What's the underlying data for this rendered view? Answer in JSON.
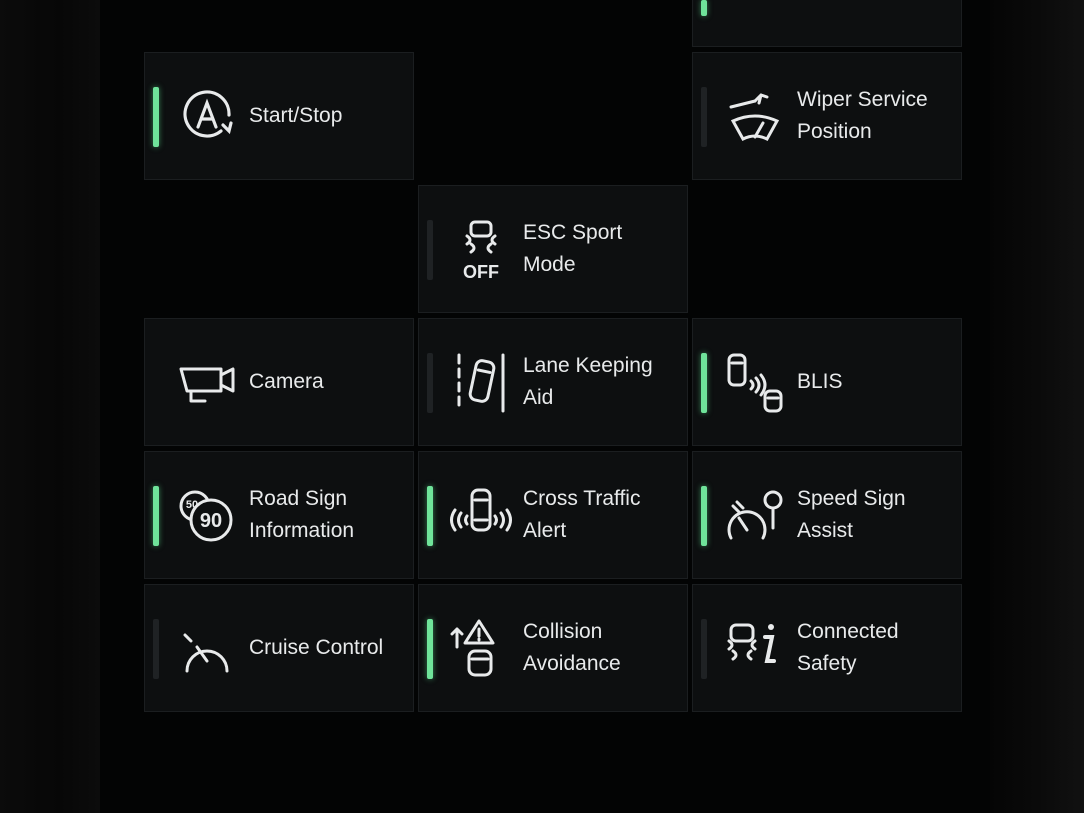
{
  "tiles": {
    "start_stop": {
      "label": "Start/Stop",
      "icon": "auto-start-stop-icon",
      "active": true
    },
    "wiper": {
      "label": "Wiper Service\nPosition",
      "icon": "wiper-service-icon",
      "active": false
    },
    "esc": {
      "label": "ESC Sport Mode",
      "icon": "esc-off-icon",
      "active": false
    },
    "camera": {
      "label": "Camera",
      "icon": "camera-icon",
      "active": false
    },
    "lane": {
      "label": "Lane Keeping\nAid",
      "icon": "lane-keeping-icon",
      "active": false
    },
    "blis": {
      "label": "BLIS",
      "icon": "blind-spot-icon",
      "active": true
    },
    "road_sign": {
      "label": "Road Sign\nInformation",
      "icon": "road-sign-icon",
      "active": true,
      "sign_small": "50",
      "sign_large": "90"
    },
    "cross_traffic": {
      "label": "Cross Traffic\nAlert",
      "icon": "cross-traffic-icon",
      "active": true
    },
    "speed_sign": {
      "label": "Speed Sign\nAssist",
      "icon": "speed-sign-icon",
      "active": true
    },
    "cruise": {
      "label": "Cruise Control",
      "icon": "cruise-control-icon",
      "active": false
    },
    "collision": {
      "label": "Collision\nAvoidance",
      "icon": "collision-avoidance-icon",
      "active": true
    },
    "connected": {
      "label": "Connected\nSafety",
      "icon": "connected-safety-icon",
      "active": false
    }
  },
  "esc_off_text": "OFF",
  "colors": {
    "active_indicator": "#6fe39a",
    "inactive_indicator": "#1f2224",
    "tile_bg": "#0d0f10",
    "text": "#e8eaeb"
  }
}
